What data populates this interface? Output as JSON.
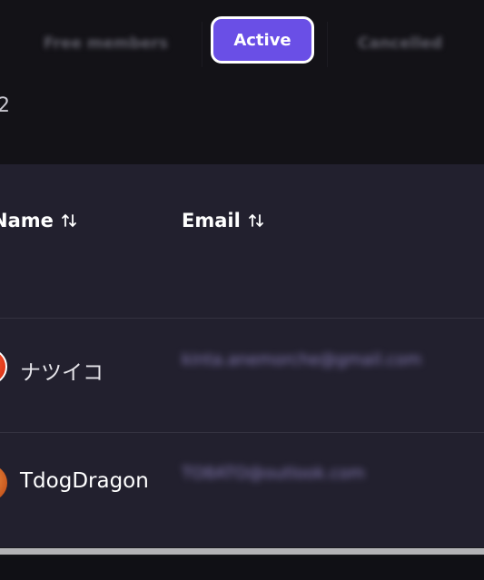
{
  "tabs": {
    "free_members": "Free members",
    "active": "Active",
    "cancelled": "Cancelled"
  },
  "member_count": "2",
  "table": {
    "headers": {
      "name": "Name",
      "email": "Email"
    },
    "rows": [
      {
        "name": "ナツイコ",
        "email": "kinta.anemorche@gmail.com",
        "avatar": "avatar-orange-red"
      },
      {
        "name": "TdogDragon",
        "email": "TO8ATO@outlook.com",
        "avatar": "avatar-orange-basketball"
      }
    ]
  },
  "colors": {
    "accent": "#6a4fe6",
    "background": "#131217",
    "table_bg": "#22202e"
  }
}
